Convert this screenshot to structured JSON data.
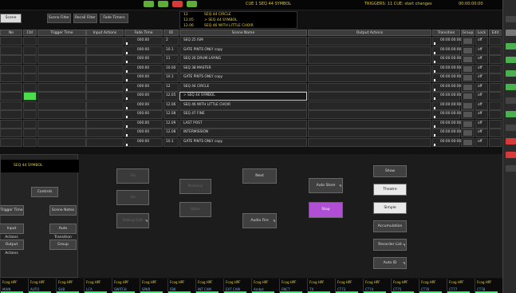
{
  "topbar": {
    "status_left": "CUE 1 SEQ 44 SYMBOL",
    "status_mid": "TRIGGERS: 11 CUE: start changes",
    "clock": "00:00:00:00",
    "indicators": [
      "#5fae3a",
      "#5fae3a",
      "#d63a3a",
      "#5fae3a"
    ]
  },
  "tabs": [
    {
      "label": "Scene View",
      "active": true
    },
    {
      "label": "Scene Filter",
      "active": false
    },
    {
      "label": "Recall Filter",
      "active": false
    },
    {
      "label": "Fade Timers",
      "active": false
    }
  ],
  "cue_panel": [
    {
      "id": "12",
      "name": "SEQ 44 CIRCLE"
    },
    {
      "id": "12.05",
      "name": "> SEQ 44 SYMBOL"
    },
    {
      "id": "12.06",
      "name": "SEQ 46 WITH LITTLE CHOIR"
    }
  ],
  "table": {
    "headers": [
      "No",
      "Ctrl",
      "Trigger Time",
      "Input Actions",
      "Fade Time",
      "ID",
      "Scene Name",
      "Output Actions",
      "Transition",
      "Group",
      "Lock",
      "Edit"
    ],
    "rows": [
      {
        "fade": "000:00",
        "id": "2",
        "name": "SEQ 25 ISM",
        "trans": "00:00:00:00",
        "lock": "off",
        "selected": false
      },
      {
        "fade": "000:00",
        "id": "10.1",
        "name": "GATE PINTS ONLY copy",
        "trans": "00:00:00:00",
        "lock": "off",
        "selected": false
      },
      {
        "fade": "000:00",
        "id": "11",
        "name": "SEQ 26 DRUM LAYING",
        "trans": "00:00:00:00",
        "lock": "off",
        "selected": false
      },
      {
        "fade": "000:00",
        "id": "10.00",
        "name": "SEQ 38 MASTER",
        "trans": "00:00:00:00",
        "lock": "off",
        "selected": false
      },
      {
        "fade": "000:00",
        "id": "10.1",
        "name": "GATE PINTS ONLY copy",
        "trans": "00:00:00:00",
        "lock": "off",
        "selected": false
      },
      {
        "fade": "000:00",
        "id": "12",
        "name": "SEQ 44 CIRCLE",
        "trans": "00:00:00:00",
        "lock": "off",
        "selected": false
      },
      {
        "fade": "000:00",
        "id": "12.05",
        "name": "> SEQ 44 SYMBOL",
        "trans": "00:00:00:00",
        "lock": "off",
        "selected": true
      },
      {
        "fade": "000:00",
        "id": "12.06",
        "name": "SEQ 46 WITH LITTLE CHOIR",
        "trans": "00:00:00:00",
        "lock": "off",
        "selected": false
      },
      {
        "fade": "000:00",
        "id": "12.08",
        "name": "SEQ 47 FINE",
        "trans": "00:00:00:00",
        "lock": "off",
        "selected": false
      },
      {
        "fade": "000:00",
        "id": "12.09",
        "name": "LAST POST",
        "trans": "00:00:00:00",
        "lock": "off",
        "selected": false
      },
      {
        "fade": "000:00",
        "id": "12.08",
        "name": "INTERMISSION",
        "trans": "00:00:00:00",
        "lock": "off",
        "selected": false
      },
      {
        "fade": "000:00",
        "id": "10.1",
        "name": "GATE PINTS ONLY copy",
        "trans": "00:00:00:00",
        "lock": "off",
        "selected": false
      }
    ]
  },
  "current_scene": "SEQ 44 SYMBOL",
  "left_buttons": {
    "controls": "Controls",
    "trigger_time": "Trigger Time",
    "scene_notes": "Scene Notes",
    "input_actions": "Input Actions",
    "auto_transition": "Auto Transition",
    "output_actions": "Output Actions",
    "group": "Group"
  },
  "center_buttons": {
    "go": "Go",
    "go2": "Go",
    "debug_edit": "Debug Edit",
    "previous": "Previous",
    "store": "Store",
    "next": "Next",
    "audio_fire": "Audio Fire",
    "auto_store": "Auto Store",
    "stop": "Stop"
  },
  "right_buttons": {
    "show": "Show",
    "theatre": "Theatre",
    "simple": "Simple",
    "accumulation": "Accumulation",
    "recorder_list": "Recorder List",
    "auto_id": "Auto ID"
  },
  "bottom_cells": [
    {
      "top": "Fcog HPF",
      "bot": "MAIN"
    },
    {
      "top": "Fcog HPF",
      "bot": "AUTO"
    },
    {
      "top": "Fcog HPF",
      "bot": "SUB"
    },
    {
      "top": "Fcog HPF",
      "bot": "LCA"
    },
    {
      "top": "Fcog HPF",
      "bot": "SWITCH"
    },
    {
      "top": "Fcog HPF",
      "bot": "SPKR"
    },
    {
      "top": "Fcog HPF",
      "bot": "FBK"
    },
    {
      "top": "Fcog HPF",
      "bot": "INT CAM"
    },
    {
      "top": "Fcog HPF",
      "bot": "EXT CAM"
    },
    {
      "top": "Fcog HPF",
      "bot": "Ambst"
    },
    {
      "top": "Fcog HPF",
      "bot": "FNCT"
    },
    {
      "top": "Fcog HPF",
      "bot": "TX"
    },
    {
      "top": "Fcog HPF",
      "bot": "CT73"
    },
    {
      "top": "Fcog HPF",
      "bot": "CT74"
    },
    {
      "top": "Fcog HPF",
      "bot": "CT75"
    },
    {
      "top": "Fcog HPF",
      "bot": "CT76"
    },
    {
      "top": "Fcog HPF",
      "bot": "CT77"
    },
    {
      "top": "Fcog HPF",
      "bot": "CT78"
    }
  ],
  "right_strip": [
    "#444",
    "#777",
    "#4caf50",
    "#4caf50",
    "#4caf50",
    "#4caf50",
    "#444",
    "#4caf50",
    "#444",
    "#d83a3a",
    "#d83a3a",
    "#444"
  ]
}
